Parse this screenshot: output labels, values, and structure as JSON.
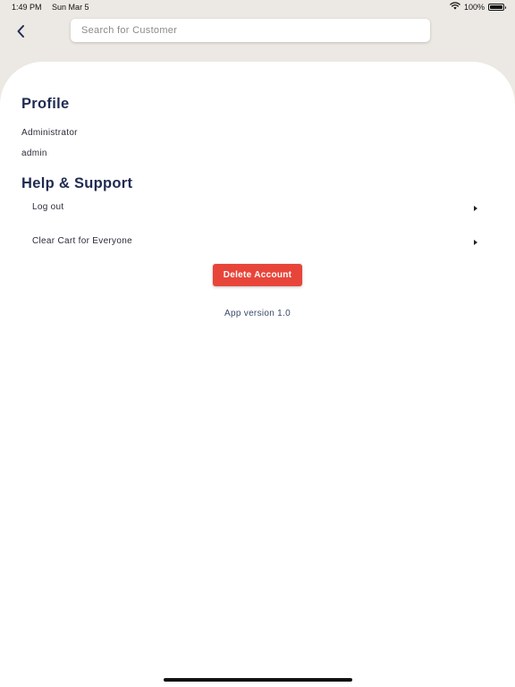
{
  "status_bar": {
    "time": "1:49 PM",
    "date": "Sun Mar 5",
    "battery_percent": "100%",
    "icons": [
      "wifi-icon",
      "battery-icon"
    ]
  },
  "header": {
    "back_icon": "chevron-left-icon",
    "search": {
      "placeholder": "Search for Customer",
      "value": ""
    }
  },
  "profile": {
    "title": "Profile",
    "role": "Administrator",
    "username": "admin"
  },
  "help_support": {
    "title": "Help & Support",
    "items": [
      {
        "label": "Log out",
        "icon": "caret-right-icon"
      },
      {
        "label": "Clear Cart for Everyone",
        "icon": "caret-right-icon"
      }
    ]
  },
  "delete_account": {
    "label": "Delete Account"
  },
  "footer": {
    "app_version": "App version 1.0"
  },
  "colors": {
    "background": "#ece8e3",
    "card": "#ffffff",
    "title_text": "#1f2b50",
    "danger": "#e8453a"
  }
}
